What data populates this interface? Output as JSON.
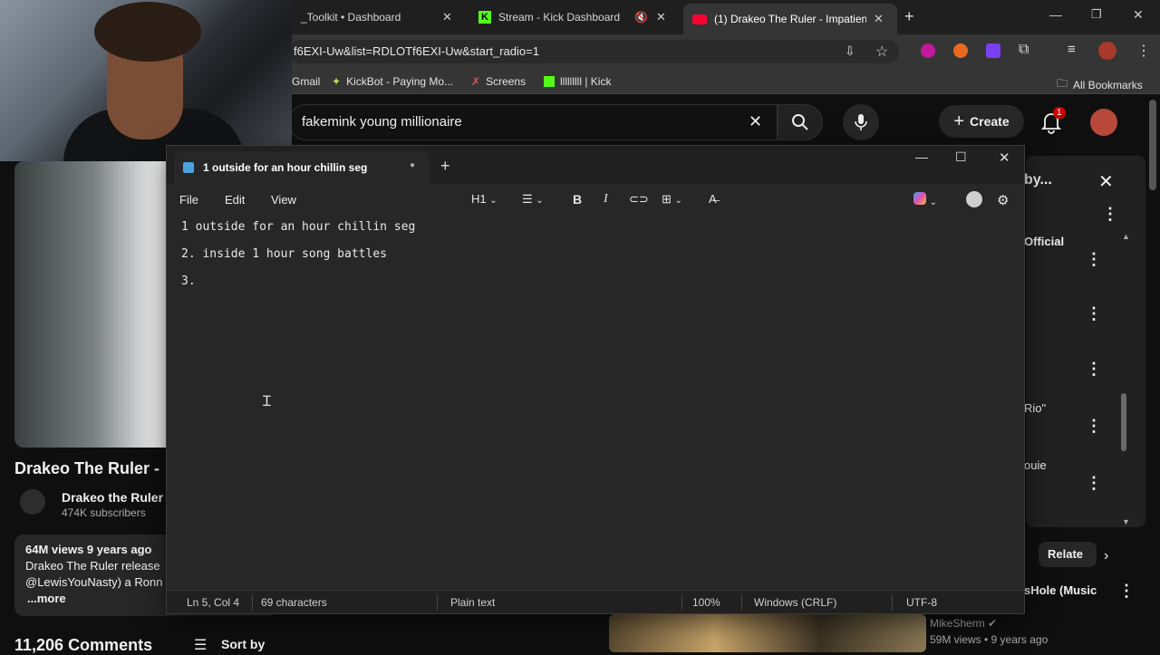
{
  "browser": {
    "tabs": [
      {
        "label": "_Toolkit • Dashboard"
      },
      {
        "label": "Stream - Kick Dashboard"
      },
      {
        "label": "(1) Drakeo The Ruler - Impatien"
      }
    ],
    "url": "f6EXI-Uw&list=RDLOTf6EXI-Uw&start_radio=1",
    "bookmarks": [
      "Gmail",
      "KickBot - Paying Mo...",
      "Screens",
      "lllllllll | Kick"
    ],
    "all_bookmarks": "All Bookmarks"
  },
  "youtube": {
    "search_value": "fakemink young millionaire",
    "create_label": "Create",
    "notification_count": "1",
    "video_title": "Drakeo The Ruler -",
    "channel_name": "Drakeo the Ruler",
    "subscribers": "474K subscribers",
    "desc_stats": "64M views  9 years ago",
    "desc_line1": "Drakeo The Ruler release",
    "desc_line2": "@LewisYouNasty) a Ronn",
    "desc_more": "...more",
    "comments_count": "11,206 Comments",
    "sort_by": "Sort by",
    "sidebar": {
      "title": "by...",
      "items": [
        "Official",
        "Rio\"",
        "ouie"
      ],
      "related_chip": "Relate",
      "hole_title": "sHole (Music",
      "next_channel": "MikeSherm",
      "next_meta": "59M views • 9 years ago"
    }
  },
  "notepad": {
    "tab_title": "1 outside for an hour chillin seg",
    "menu": {
      "file": "File",
      "edit": "Edit",
      "view": "View"
    },
    "heading_select": "H1",
    "lines": [
      "1 outside for an hour chillin seg",
      "2. inside 1 hour song battles",
      "3."
    ],
    "status": {
      "position": "Ln 5, Col 4",
      "characters": "69 characters",
      "format": "Plain text",
      "zoom": "100%",
      "line_ending": "Windows (CRLF)",
      "encoding": "UTF-8"
    }
  },
  "colors": {
    "youtube_red": "#ff0033",
    "kick_green": "#53fc18",
    "notepad_bg": "#272727"
  }
}
